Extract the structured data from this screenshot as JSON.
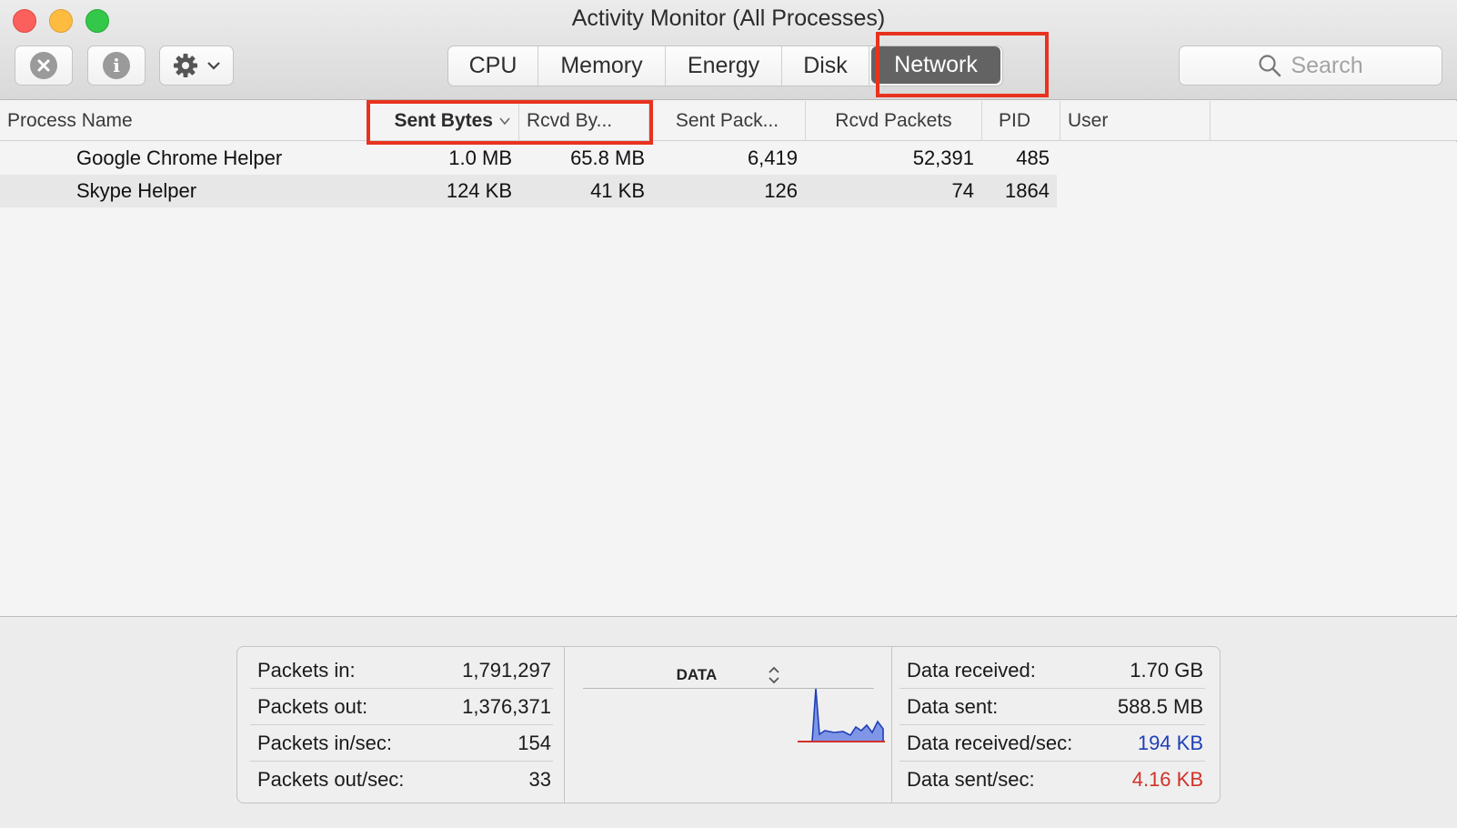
{
  "window": {
    "title": "Activity Monitor (All Processes)"
  },
  "toolbar": {
    "tabs": [
      {
        "label": "CPU",
        "active": false
      },
      {
        "label": "Memory",
        "active": false
      },
      {
        "label": "Energy",
        "active": false
      },
      {
        "label": "Disk",
        "active": false
      },
      {
        "label": "Network",
        "active": true
      }
    ],
    "search": {
      "placeholder": "Search"
    }
  },
  "table": {
    "columns": [
      "Process Name",
      "Sent Bytes",
      "Rcvd By...",
      "Sent Pack...",
      "Rcvd Packets",
      "PID",
      "User"
    ],
    "sorted_column": "Sent Bytes",
    "rows": [
      {
        "name": "Google Chrome Helper",
        "sent_bytes": "1.0 MB",
        "rcvd_bytes": "65.8 MB",
        "sent_packets": "6,419",
        "rcvd_packets": "52,391",
        "pid": "485",
        "user": ""
      },
      {
        "name": "Skype Helper",
        "sent_bytes": "124 KB",
        "rcvd_bytes": "41 KB",
        "sent_packets": "126",
        "rcvd_packets": "74",
        "pid": "1864",
        "user": ""
      }
    ]
  },
  "summary": {
    "left": [
      {
        "label": "Packets in:",
        "value": "1,791,297"
      },
      {
        "label": "Packets out:",
        "value": "1,376,371"
      },
      {
        "label": "Packets in/sec:",
        "value": "154"
      },
      {
        "label": "Packets out/sec:",
        "value": "33"
      }
    ],
    "graph": {
      "label": "DATA"
    },
    "right": [
      {
        "label": "Data received:",
        "value": "1.70 GB",
        "color": ""
      },
      {
        "label": "Data sent:",
        "value": "588.5 MB",
        "color": ""
      },
      {
        "label": "Data received/sec:",
        "value": "194 KB",
        "color": "#1f3fb8"
      },
      {
        "label": "Data sent/sec:",
        "value": "4.16 KB",
        "color": "#d0322a"
      }
    ]
  },
  "colors": {
    "highlight_box": "#e8321f",
    "active_tab": "#636363",
    "received": "#1f3fb8",
    "sent": "#d0322a"
  }
}
